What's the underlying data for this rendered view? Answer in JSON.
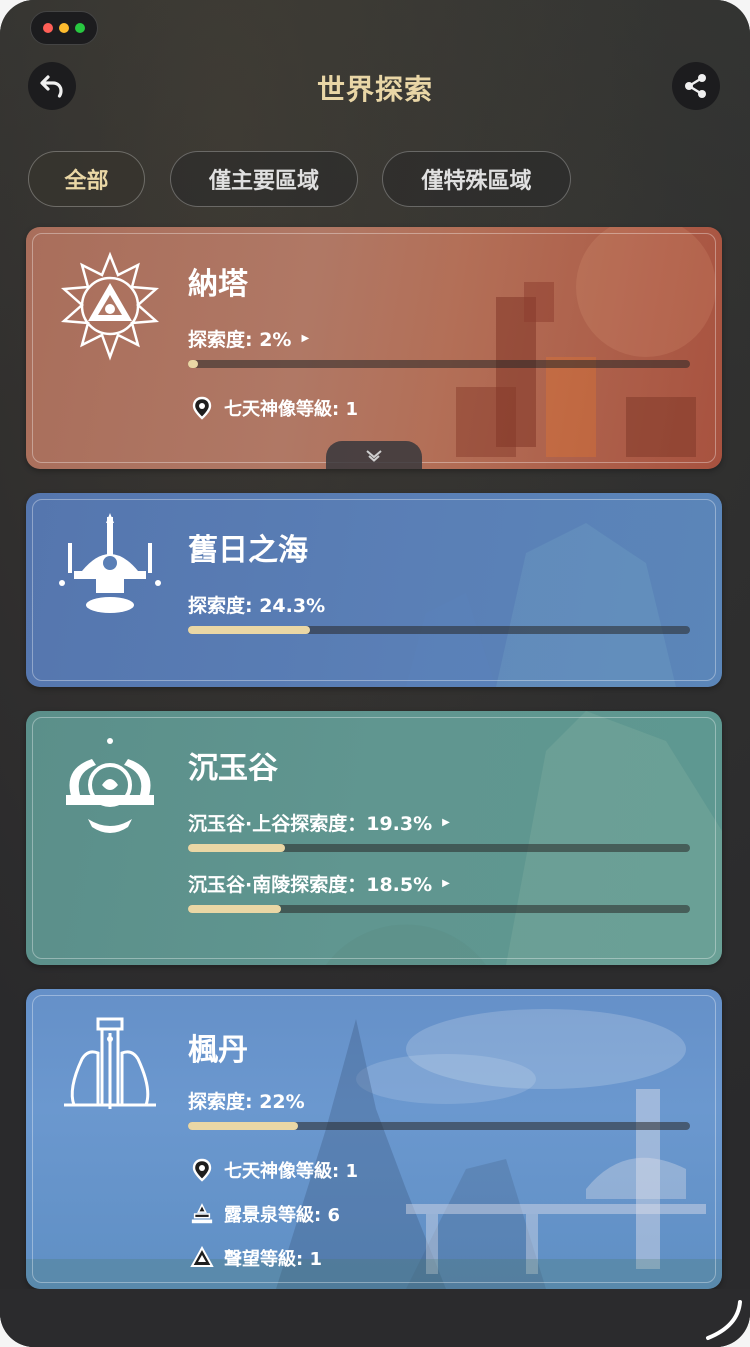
{
  "window": {
    "title": "世界探索"
  },
  "header": {
    "back_icon": "back-arrow-icon",
    "share_icon": "share-icon"
  },
  "filters": [
    {
      "label": "全部",
      "active": true
    },
    {
      "label": "僅主要區域",
      "active": false
    },
    {
      "label": "僅特殊區域",
      "active": false
    }
  ],
  "regions": [
    {
      "name": "納塔",
      "emblem": "natlan-emblem-icon",
      "color": "#b07865",
      "progress_label": "探索度: 2%",
      "progress": 2,
      "has_arrow": true,
      "stats": [
        {
          "icon": "map-pin-icon",
          "label": "七天神像等級: 1"
        }
      ],
      "collapsed": true
    },
    {
      "name": "舊日之海",
      "emblem": "sea-of-bygone-eras-emblem-icon",
      "color": "#5a7fb6",
      "progress_label": "探索度: 24.3%",
      "progress": 24.3,
      "has_arrow": false,
      "stats": []
    },
    {
      "name": "沉玉谷",
      "emblem": "chenyu-vale-emblem-icon",
      "color": "#609690",
      "subareas": [
        {
          "label": "沉玉谷·上谷探索度：19.3%",
          "progress": 19.3
        },
        {
          "label": "沉玉谷·南陵探索度：18.5%",
          "progress": 18.5
        }
      ]
    },
    {
      "name": "楓丹",
      "emblem": "fontaine-emblem-icon",
      "color": "#6b98cf",
      "progress_label": "探索度: 22%",
      "progress": 22,
      "has_arrow": false,
      "stats": [
        {
          "icon": "map-pin-icon",
          "label": "七天神像等級: 1"
        },
        {
          "icon": "fountain-icon",
          "label": "露景泉等級: 6"
        },
        {
          "icon": "reputation-icon",
          "label": "聲望等級: 1"
        }
      ]
    }
  ],
  "colors": {
    "accent": "#ead7a5",
    "background": "#2b2b2d"
  }
}
